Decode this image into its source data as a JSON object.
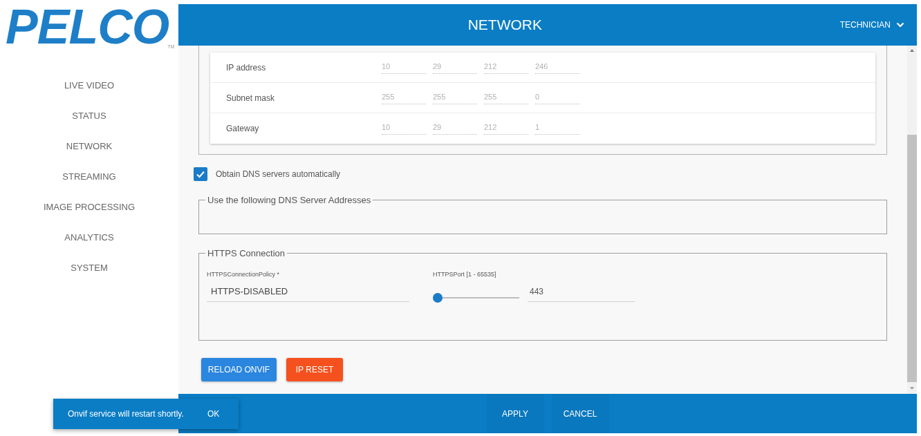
{
  "logo": {
    "text": "PELCO",
    "trademark": "TM"
  },
  "sidebar": {
    "items": [
      "LIVE VIDEO",
      "STATUS",
      "NETWORK",
      "STREAMING",
      "IMAGE PROCESSING",
      "ANALYTICS",
      "SYSTEM"
    ]
  },
  "header": {
    "title": "NETWORK",
    "user_menu": "TECHNICIAN"
  },
  "ip_settings": {
    "disabled": true,
    "rows": [
      {
        "label": "IP address",
        "octets": [
          "10",
          "29",
          "212",
          "246"
        ]
      },
      {
        "label": "Subnet mask",
        "octets": [
          "255",
          "255",
          "255",
          "0"
        ]
      },
      {
        "label": "Gateway",
        "octets": [
          "10",
          "29",
          "212",
          "1"
        ]
      }
    ]
  },
  "dns_auto": {
    "label": "Obtain DNS servers automatically",
    "checked": true
  },
  "dns_servers": {
    "legend": "Use the following DNS Server Addresses"
  },
  "https": {
    "legend": "HTTPS Connection",
    "policy": {
      "label": "HTTPSConnectionPolicy *",
      "value": "HTTPS-DISABLED"
    },
    "port": {
      "label": "HTTPSPort [1 - 65535]",
      "level": 0,
      "value": "443"
    }
  },
  "actions": [
    {
      "label": "RELOAD ONVIF",
      "kind": "primary"
    },
    {
      "label": "IP RESET",
      "kind": "danger"
    }
  ],
  "footer": {
    "buttons": [
      "APPLY",
      "CANCEL"
    ]
  },
  "snackbar": {
    "message": "Onvif service will restart shortly.",
    "action": "OK"
  }
}
